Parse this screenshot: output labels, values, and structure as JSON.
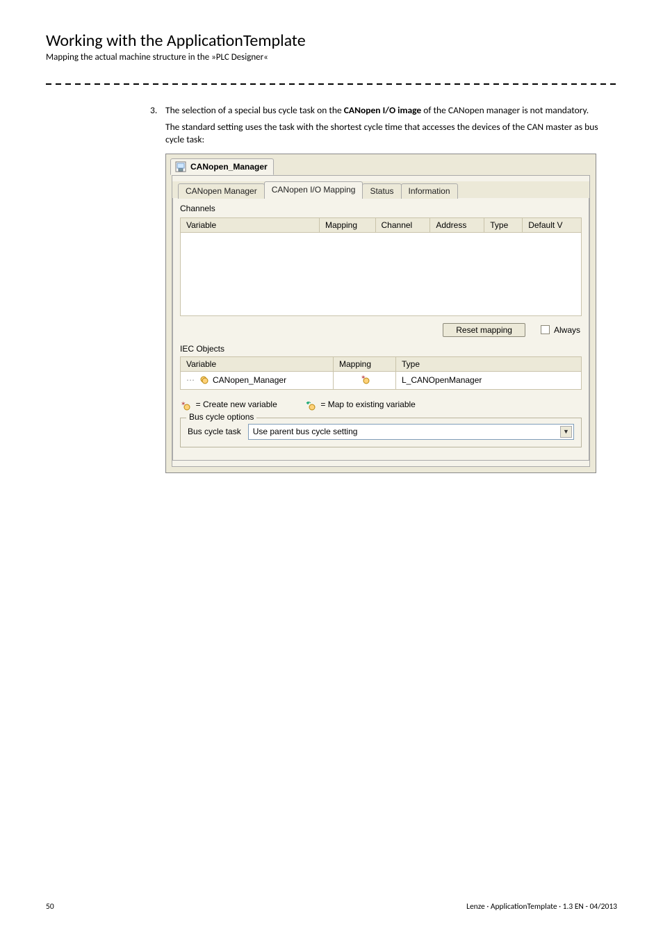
{
  "page": {
    "title": "Working with the ApplicationTemplate",
    "subtitle": "Mapping the actual machine structure in the »PLC Designer«"
  },
  "step": {
    "number": "3.",
    "text_before_bold": "The selection of a special bus cycle task on the ",
    "text_bold": "CANopen I/O image",
    "text_after_bold": " of the CANopen manager is not mandatory.",
    "followup": "The standard setting uses the task with the shortest cycle time that accesses the devices of the CAN master as bus cycle task:"
  },
  "screenshot": {
    "title_tab": "CANopen_Manager",
    "nav_tabs": [
      "CANopen Manager",
      "CANopen I/O Mapping",
      "Status",
      "Information"
    ],
    "nav_tabs_active_index": 1,
    "channels_label": "Channels",
    "channels_headers": [
      "Variable",
      "Mapping",
      "Channel",
      "Address",
      "Type",
      "Default V"
    ],
    "reset_button": "Reset mapping",
    "always_checkbox_label": "Always ",
    "iec_section_title": "IEC Objects",
    "iec_headers": [
      "Variable",
      "Mapping",
      "Type"
    ],
    "iec_row": {
      "variable": "CANopen_Manager",
      "type": "L_CANOpenManager"
    },
    "legend": {
      "create_new": "= Create new variable",
      "map_existing": "= Map to existing variable"
    },
    "bus_options": {
      "fieldset_legend": "Bus cycle options",
      "label": "Bus cycle task",
      "combo_value": "Use parent bus cycle setting"
    }
  },
  "footer": {
    "page_number": "50",
    "doc_id": "Lenze · ApplicationTemplate · 1.3 EN - 04/2013"
  }
}
